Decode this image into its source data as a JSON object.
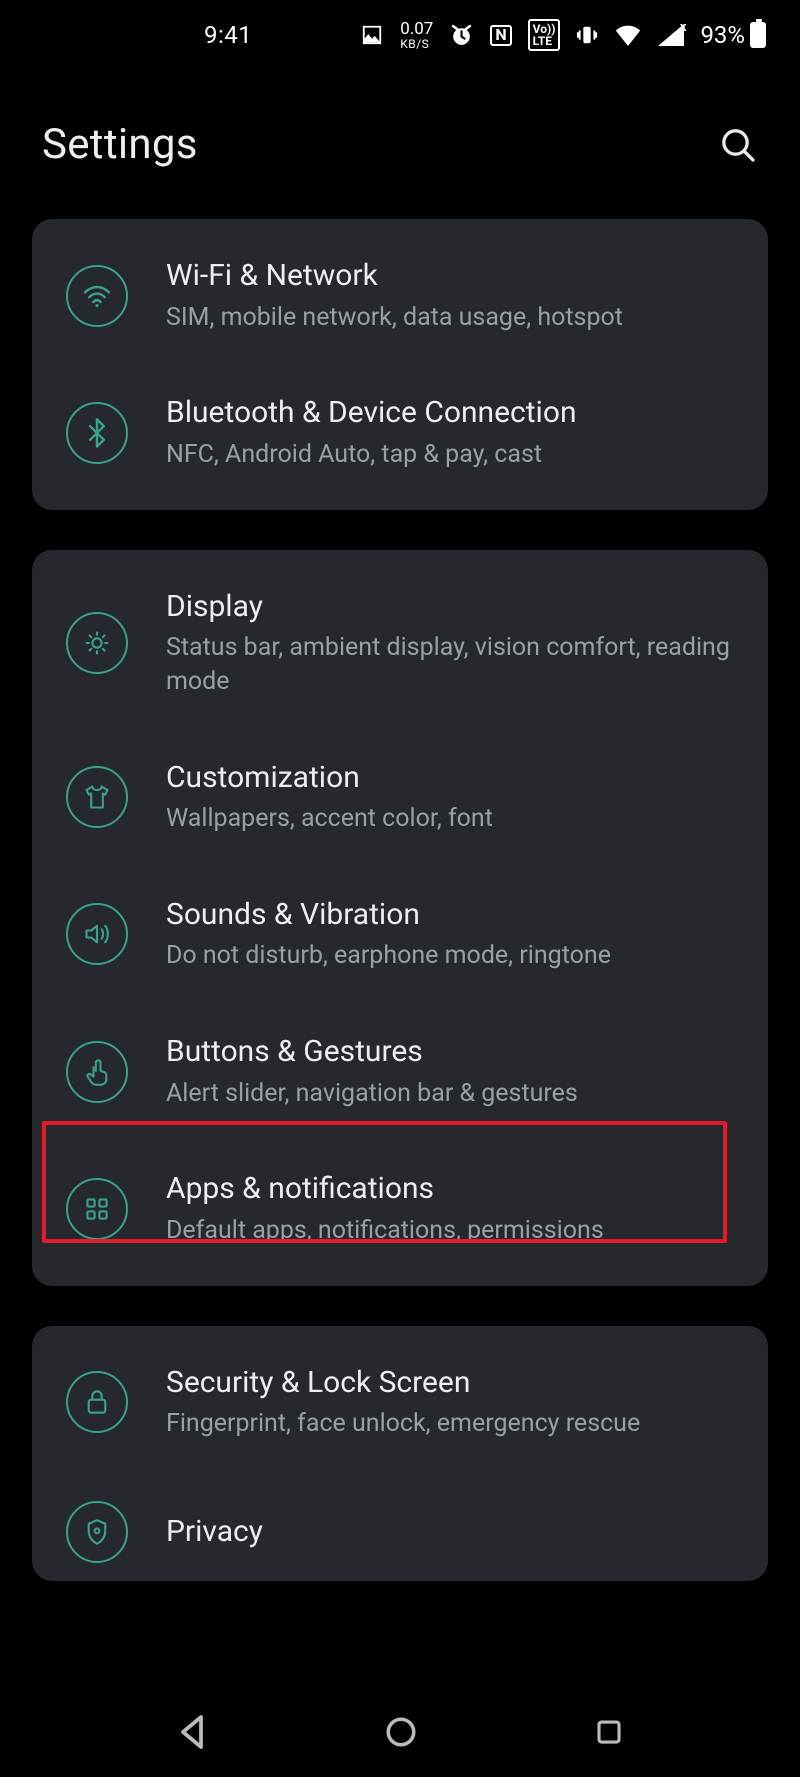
{
  "status_bar": {
    "time": "9:41",
    "net_rate": "0.07",
    "net_unit": "KB/S",
    "volte": "Vo›LTE",
    "nfc": "N",
    "battery_pct": "93%"
  },
  "header": {
    "title": "Settings"
  },
  "groups": [
    {
      "items": [
        {
          "id": "wifi",
          "icon": "wifi-icon",
          "title": "Wi-Fi & Network",
          "sub": "SIM, mobile network, data usage, hotspot"
        },
        {
          "id": "bluetooth",
          "icon": "bluetooth-icon",
          "title": "Bluetooth & Device Connection",
          "sub": "NFC, Android Auto, tap & pay, cast"
        }
      ]
    },
    {
      "items": [
        {
          "id": "display",
          "icon": "brightness-icon",
          "title": "Display",
          "sub": "Status bar, ambient display, vision comfort, reading mode"
        },
        {
          "id": "customization",
          "icon": "shirt-icon",
          "title": "Customization",
          "sub": "Wallpapers, accent color, font"
        },
        {
          "id": "sounds",
          "icon": "volume-icon",
          "title": "Sounds & Vibration",
          "sub": "Do not disturb, earphone mode, ringtone"
        },
        {
          "id": "buttons",
          "icon": "gesture-icon",
          "title": "Buttons & Gestures",
          "sub": "Alert slider, navigation bar & gestures"
        },
        {
          "id": "apps",
          "icon": "apps-icon",
          "title": "Apps & notifications",
          "sub": "Default apps, notifications, permissions",
          "highlighted": true
        }
      ]
    },
    {
      "items": [
        {
          "id": "security",
          "icon": "lock-icon",
          "title": "Security & Lock Screen",
          "sub": "Fingerprint, face unlock, emergency rescue"
        },
        {
          "id": "privacy",
          "icon": "shield-icon",
          "title": "Privacy",
          "sub": ""
        }
      ]
    }
  ],
  "colors": {
    "accent": "#3aa18a",
    "card": "#25282c",
    "highlight": "#e11b2a"
  }
}
